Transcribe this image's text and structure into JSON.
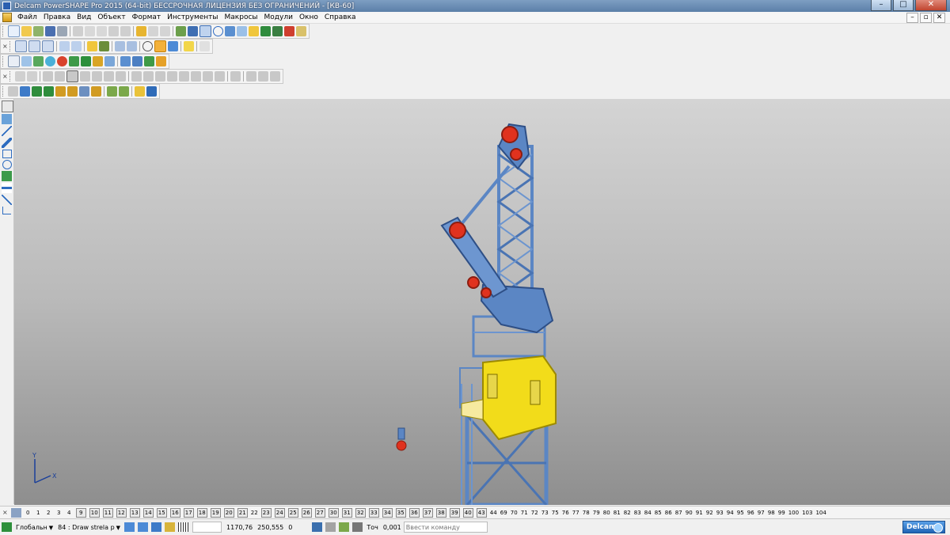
{
  "window": {
    "title": "Delcam PowerSHAPE Pro 2015 (64-bit) БЕССРОЧНАЯ ЛИЦЕНЗИЯ БЕЗ ОГРАНИЧЕНИЙ - [КВ-60]",
    "minimize": "–",
    "maximize": "□",
    "close": "✕"
  },
  "menu": {
    "items": [
      "Файл",
      "Правка",
      "Вид",
      "Объект",
      "Формат",
      "Инструменты",
      "Макросы",
      "Модули",
      "Окно",
      "Справка"
    ],
    "mdi_minimize": "–",
    "mdi_restore": "▫",
    "mdi_close": "✕"
  },
  "toolbars": {
    "close_glyph": "×"
  },
  "levels": {
    "items": [
      {
        "label": "0",
        "boxed": false
      },
      {
        "label": "1",
        "boxed": false
      },
      {
        "label": "2",
        "boxed": false
      },
      {
        "label": "3",
        "boxed": false
      },
      {
        "label": "4",
        "boxed": false
      },
      {
        "label": "9",
        "boxed": true
      },
      {
        "label": "10",
        "boxed": true
      },
      {
        "label": "11",
        "boxed": true
      },
      {
        "label": "12",
        "boxed": true
      },
      {
        "label": "13",
        "boxed": true
      },
      {
        "label": "14",
        "boxed": true
      },
      {
        "label": "15",
        "boxed": true
      },
      {
        "label": "16",
        "boxed": true
      },
      {
        "label": "17",
        "boxed": true
      },
      {
        "label": "18",
        "boxed": true
      },
      {
        "label": "19",
        "boxed": true
      },
      {
        "label": "20",
        "boxed": true
      },
      {
        "label": "21",
        "boxed": true
      },
      {
        "label": "22",
        "boxed": false
      },
      {
        "label": "23",
        "boxed": true
      },
      {
        "label": "24",
        "boxed": true
      },
      {
        "label": "25",
        "boxed": true
      },
      {
        "label": "26",
        "boxed": true
      },
      {
        "label": "27",
        "boxed": true
      },
      {
        "label": "30",
        "boxed": true
      },
      {
        "label": "31",
        "boxed": true
      },
      {
        "label": "32",
        "boxed": true
      },
      {
        "label": "33",
        "boxed": true
      },
      {
        "label": "34",
        "boxed": true
      },
      {
        "label": "35",
        "boxed": true
      },
      {
        "label": "36",
        "boxed": true
      },
      {
        "label": "37",
        "boxed": true
      },
      {
        "label": "38",
        "boxed": true
      },
      {
        "label": "39",
        "boxed": true
      },
      {
        "label": "40",
        "boxed": true
      },
      {
        "label": "43",
        "boxed": true
      },
      {
        "label": "44",
        "boxed": false
      },
      {
        "label": "69",
        "boxed": false
      },
      {
        "label": "70",
        "boxed": false
      },
      {
        "label": "71",
        "boxed": false
      },
      {
        "label": "72",
        "boxed": false
      },
      {
        "label": "73",
        "boxed": false
      },
      {
        "label": "75",
        "boxed": false
      },
      {
        "label": "76",
        "boxed": false
      },
      {
        "label": "77",
        "boxed": false
      },
      {
        "label": "78",
        "boxed": false
      },
      {
        "label": "79",
        "boxed": false
      },
      {
        "label": "80",
        "boxed": false
      },
      {
        "label": "81",
        "boxed": false
      },
      {
        "label": "82",
        "boxed": false
      },
      {
        "label": "83",
        "boxed": false
      },
      {
        "label": "84",
        "boxed": false
      },
      {
        "label": "85",
        "boxed": false
      },
      {
        "label": "86",
        "boxed": false
      },
      {
        "label": "87",
        "boxed": false
      },
      {
        "label": "90",
        "boxed": false
      },
      {
        "label": "91",
        "boxed": false
      },
      {
        "label": "92",
        "boxed": false
      },
      {
        "label": "93",
        "boxed": false
      },
      {
        "label": "94",
        "boxed": false
      },
      {
        "label": "95",
        "boxed": false
      },
      {
        "label": "96",
        "boxed": false
      },
      {
        "label": "97",
        "boxed": false
      },
      {
        "label": "98",
        "boxed": false
      },
      {
        "label": "99",
        "boxed": false
      },
      {
        "label": "100",
        "boxed": false
      },
      {
        "label": "103",
        "boxed": false
      },
      {
        "label": "104",
        "boxed": false
      }
    ]
  },
  "status": {
    "workplane": "Глобальн",
    "level_select": "84 : Draw strela p",
    "coord_x": "1170,76",
    "coord_y": "250,555",
    "coord_z": "0",
    "tolerance_label": "Точ",
    "tolerance_value": "0,001",
    "command_placeholder": "Ввести команду",
    "brand": "Delcam"
  },
  "axes": {
    "x": "X",
    "y": "Y"
  },
  "colors": {
    "crane_blue": "#5b86c4",
    "crane_blue_dark": "#2e4f86",
    "cab_yellow": "#f2dc1a",
    "sheave_red": "#e0321e"
  }
}
